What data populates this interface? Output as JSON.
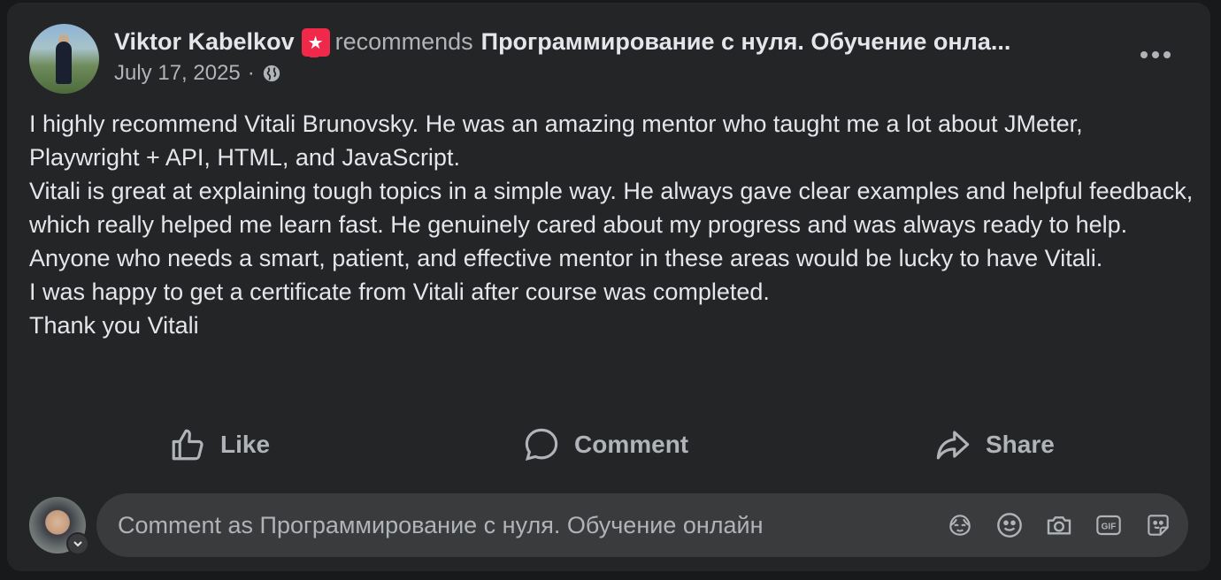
{
  "post": {
    "author": "Viktor Kabelkov",
    "action_text": "recommends",
    "page_name": "Программирование с нуля. Обучение онла...",
    "date": "July 17, 2025",
    "separator": "·",
    "audience_icon": "globe-icon",
    "recommend_icon": "recommend-star-icon",
    "body_lines": [
      "I highly recommend Vitali Brunovsky. He was an amazing mentor who taught me a lot about JMeter, Playwright + API, HTML, and JavaScript.",
      "Vitali is great at explaining tough topics in a simple way. He always gave clear examples and helpful feedback, which really helped me learn fast. He genuinely cared about my progress and was always ready to help.",
      "Anyone who needs a smart, patient, and effective mentor in these areas would be lucky to have Vitali.",
      "I was happy to get a certificate from Vitali after course was completed.",
      "Thank you Vitali"
    ]
  },
  "actions": {
    "like_label": "Like",
    "comment_label": "Comment",
    "share_label": "Share"
  },
  "composer": {
    "placeholder": "Comment as Программирование с нуля. Обучение онлайн",
    "value": "",
    "icons": [
      "avatar-sticker-icon",
      "emoji-icon",
      "camera-icon",
      "gif-icon",
      "sticker-icon"
    ]
  },
  "colors": {
    "card_bg": "#242526",
    "page_bg": "#18191a",
    "primary_text": "#e4e6eb",
    "secondary_text": "#b0b3b8",
    "recommend_accent": "#f02849",
    "input_bg": "#3a3b3c"
  }
}
